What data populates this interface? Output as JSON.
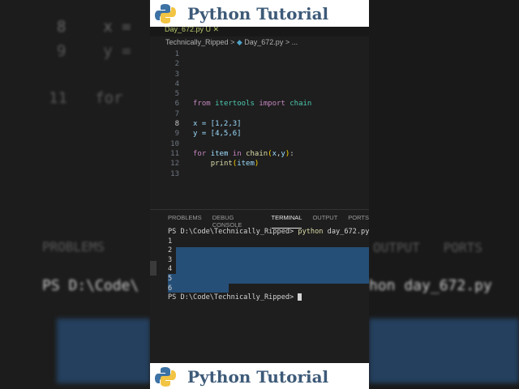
{
  "banner": {
    "title": "Python Tutorial"
  },
  "editor": {
    "tab_label": "Day_672.py U",
    "breadcrumb": {
      "folder": "Technically_Ripped",
      "sep": ">",
      "file": "Day_672.py",
      "more": "..."
    },
    "lines": [
      {
        "n": "1"
      },
      {
        "n": "2"
      },
      {
        "n": "3"
      },
      {
        "n": "4"
      },
      {
        "n": "5"
      },
      {
        "n": "6",
        "code": "from itertools import chain"
      },
      {
        "n": "7"
      },
      {
        "n": "8",
        "code": "x = [1,2,3]"
      },
      {
        "n": "9",
        "code": "y = [4,5,6]"
      },
      {
        "n": "10"
      },
      {
        "n": "11",
        "code": "for item in chain(x,y):"
      },
      {
        "n": "12",
        "code": "    print(item)"
      },
      {
        "n": "13"
      }
    ]
  },
  "panel": {
    "tabs": [
      "PROBLEMS",
      "DEBUG CONSOLE",
      "TERMINAL",
      "OUTPUT",
      "PORTS"
    ],
    "active": "TERMINAL"
  },
  "terminal": {
    "prompt": "PS D:\\Code\\Technically_Ripped>",
    "command": "python",
    "arg": "day_672.py",
    "output": [
      "1",
      "2",
      "3",
      "4",
      "5",
      "6"
    ]
  }
}
